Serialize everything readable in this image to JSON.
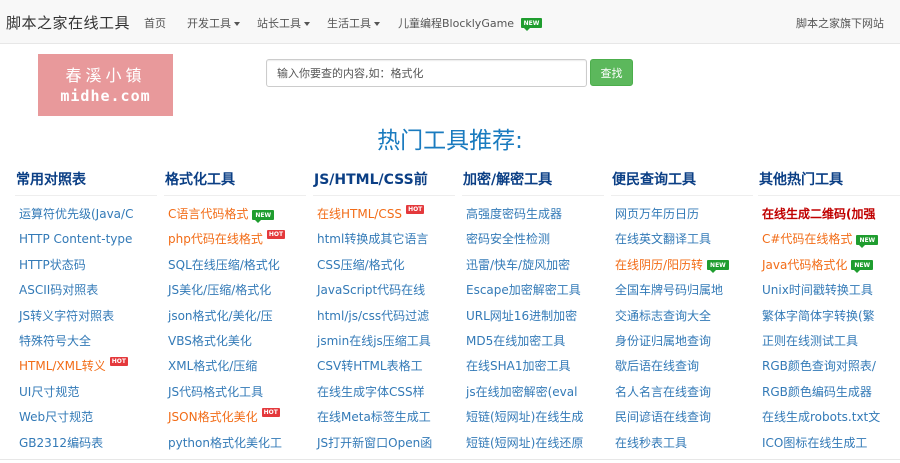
{
  "navbar": {
    "brand": "脚本之家在线工具",
    "items": [
      {
        "label": "首页",
        "dropdown": false
      },
      {
        "label": "开发工具",
        "dropdown": true
      },
      {
        "label": "站长工具",
        "dropdown": true
      },
      {
        "label": "生活工具",
        "dropdown": true
      },
      {
        "label": "儿童编程BlocklyGame",
        "dropdown": false,
        "badge": "NEW"
      }
    ],
    "right_link": "脚本之家旗下网站"
  },
  "logo": {
    "line1": "春溪小镇",
    "line2": "midhe.com"
  },
  "search": {
    "placeholder": "输入你要查的内容,如：格式化",
    "button": "查找"
  },
  "headline": "热门工具推荐:",
  "badges": {
    "new": "NEW",
    "hot": "HOT"
  },
  "colors": {
    "link": "#337ab7",
    "highlight": "#f26c17",
    "headline": "#1a7bbf",
    "search_button": "#5cb85c",
    "logo_bg": "#e79193"
  },
  "columns": [
    {
      "title": "常用对照表",
      "links": [
        {
          "text": "运算符优先级(Java/C"
        },
        {
          "text": "HTTP Content-type"
        },
        {
          "text": "HTTP状态码"
        },
        {
          "text": "ASCII码对照表"
        },
        {
          "text": "JS转义字符对照表"
        },
        {
          "text": "特殊符号大全"
        },
        {
          "text": "HTML/XML转义",
          "style": "orange",
          "badge": "HOT"
        },
        {
          "text": "UI尺寸规范"
        },
        {
          "text": "Web尺寸规范"
        },
        {
          "text": "GB2312编码表"
        }
      ]
    },
    {
      "title": "格式化工具",
      "links": [
        {
          "text": "C语言代码格式",
          "style": "orange",
          "badge": "NEW"
        },
        {
          "text": "php代码在线格式",
          "style": "orange",
          "badge": "HOT"
        },
        {
          "text": "SQL在线压缩/格式化"
        },
        {
          "text": "JS美化/压缩/格式化"
        },
        {
          "text": "json格式化/美化/压"
        },
        {
          "text": "VBS格式化美化"
        },
        {
          "text": "XML格式化/压缩"
        },
        {
          "text": "JS代码格式化工具"
        },
        {
          "text": "JSON格式化美化",
          "style": "orange",
          "badge": "HOT"
        },
        {
          "text": "python格式化美化工"
        }
      ]
    },
    {
      "title": "JS/HTML/CSS前",
      "links": [
        {
          "text": "在线HTML/CSS",
          "style": "orange",
          "badge": "HOT"
        },
        {
          "text": "html转换成其它语言"
        },
        {
          "text": "CSS压缩/格式化"
        },
        {
          "text": "JavaScript代码在线"
        },
        {
          "text": "html/js/css代码过滤"
        },
        {
          "text": "jsmin在线js压缩工具"
        },
        {
          "text": "CSV转HTML表格工"
        },
        {
          "text": "在线生成字体CSS样"
        },
        {
          "text": "在线Meta标签生成工"
        },
        {
          "text": "JS打开新窗口Open函"
        }
      ]
    },
    {
      "title": "加密/解密工具",
      "links": [
        {
          "text": "高强度密码生成器"
        },
        {
          "text": "密码安全性检测"
        },
        {
          "text": "迅雷/快车/旋风加密"
        },
        {
          "text": "Escape加密解密工具"
        },
        {
          "text": "URL网址16进制加密"
        },
        {
          "text": "MD5在线加密工具"
        },
        {
          "text": "在线SHA1加密工具"
        },
        {
          "text": "js在线加密解密(eval"
        },
        {
          "text": "短链(短网址)在线生成"
        },
        {
          "text": "短链(短网址)在线还原"
        }
      ]
    },
    {
      "title": "便民查询工具",
      "links": [
        {
          "text": "网页万年历日历"
        },
        {
          "text": "在线英文翻译工具"
        },
        {
          "text": "在线阴历/阳历转",
          "style": "orange",
          "badge": "NEW"
        },
        {
          "text": "全国车牌号码归属地"
        },
        {
          "text": "交通标志查询大全"
        },
        {
          "text": "身份证归属地查询"
        },
        {
          "text": "歇后语在线查询"
        },
        {
          "text": "名人名言在线查询"
        },
        {
          "text": "民间谚语在线查询"
        },
        {
          "text": "在线秒表工具"
        }
      ]
    },
    {
      "title": "其他热门工具",
      "links": [
        {
          "text": "在线生成二维码(加强",
          "style": "red"
        },
        {
          "text": "C#代码在线格式",
          "style": "orange",
          "badge": "NEW"
        },
        {
          "text": "Java代码格式化",
          "style": "orange",
          "badge": "NEW"
        },
        {
          "text": "Unix时间戳转换工具"
        },
        {
          "text": "繁体字简体字转换(繁"
        },
        {
          "text": "正则在线测试工具"
        },
        {
          "text": "RGB颜色查询对照表/"
        },
        {
          "text": "RGB颜色编码生成器"
        },
        {
          "text": "在线生成robots.txt文"
        },
        {
          "text": "ICO图标在线生成工"
        }
      ]
    }
  ]
}
